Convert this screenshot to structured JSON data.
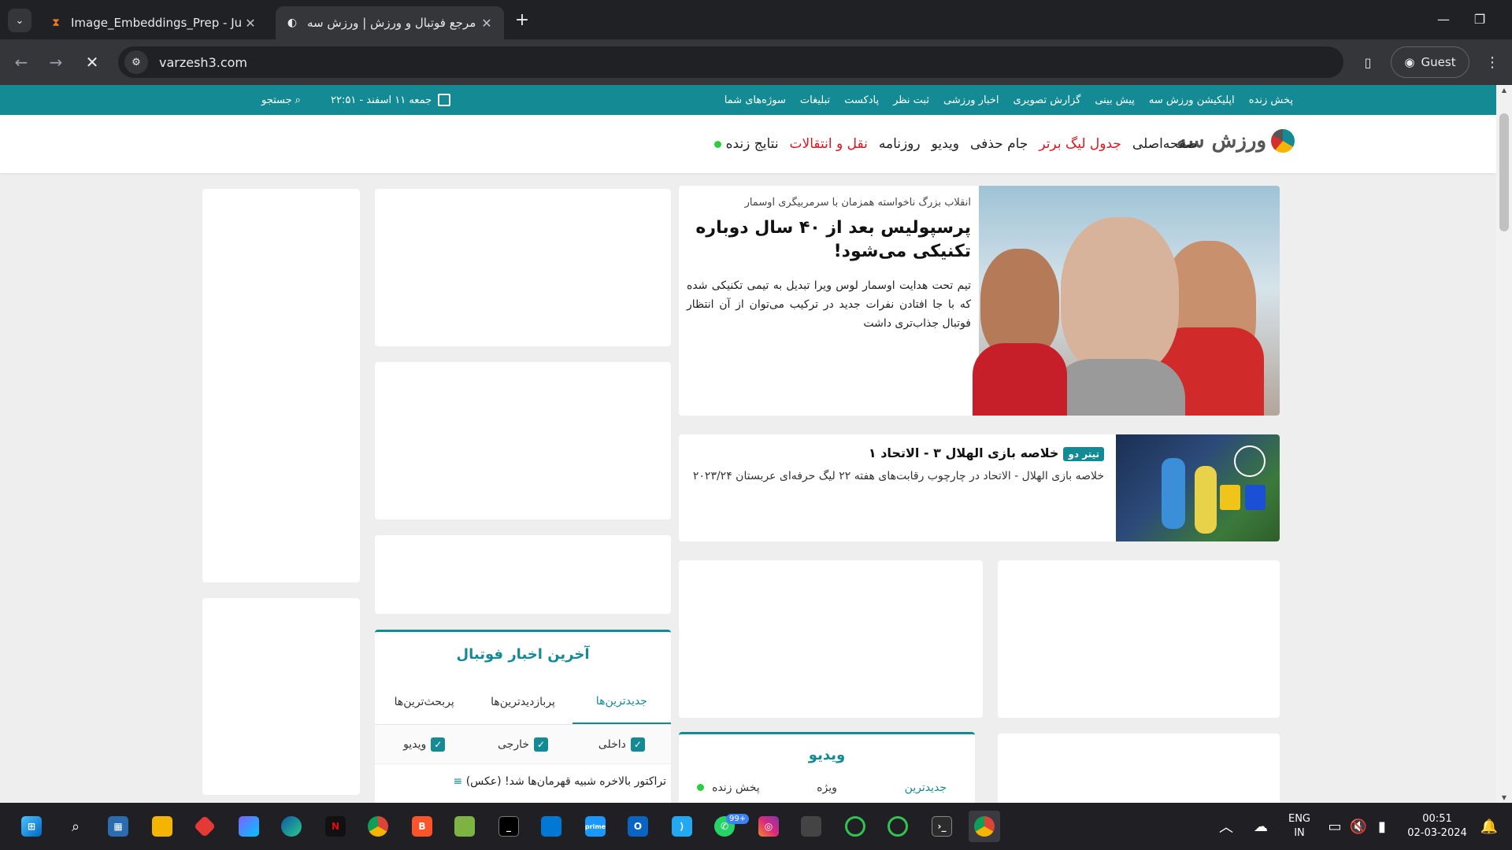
{
  "browser": {
    "tabs": [
      {
        "title": "Image_Embeddings_Prep - Jupy",
        "icon": "jupyter-hourglass-icon",
        "active": false
      },
      {
        "title": "مرجع فوتبال و ورزش | ورزش سه",
        "icon": "varzesh3-favicon-icon",
        "active": true
      }
    ],
    "url": "varzesh3.com",
    "profile_label": "Guest"
  },
  "site": {
    "topbar": {
      "menu": [
        "پخش زنده",
        "اپلیکیشن ورزش سه",
        "پیش بینی",
        "گزارش تصویری",
        "اخبار ورزشی",
        "ثبت نظر",
        "پادکست",
        "تبلیغات",
        "سوژه‌های شما"
      ],
      "date": "جمعه ۱۱ اسفند - ۲۲:۵۱",
      "search_label": "جستجو"
    },
    "logo_text": "ورزش سه",
    "nav": [
      {
        "label": "صفحه‌اصلی",
        "color": "#222222"
      },
      {
        "label": "جدول لیگ برتر",
        "color": "#e0141e"
      },
      {
        "label": "جام حذفی",
        "color": "#222222"
      },
      {
        "label": "ویدیو",
        "color": "#222222"
      },
      {
        "label": "روزنامه",
        "color": "#222222"
      },
      {
        "label": "نقل و انتقالات",
        "color": "#e0141e"
      },
      {
        "label": "نتایج زنده",
        "color": "#222222"
      }
    ],
    "hero": {
      "kicker": "انقلاب بزرگ ناخواسته همزمان با سرمربیگری اوسمار",
      "title": "پرسپولیس بعد از ۴۰ سال دوباره تکنیکی می‌شود!",
      "lead": "تیم تحت هدایت اوسمار لوس ویرا تبدیل به تیمی تکنیکی شده که با جا افتادن نفرات جدید در ترکیب می‌توان از آن انتظار فوتبال جذاب‌تری داشت"
    },
    "second_news": {
      "badge": "تیتر دو",
      "title": "خلاصه بازی الهلال ۳ - الاتحاد ۱",
      "desc": "خلاصه بازی الهلال - الاتحاد در چارچوب رقابت‌های هفته ۲۲ لیگ حرفه‌ای عربستان ۲۰۲۳/۲۴"
    },
    "football_news": {
      "heading": "آخرین اخبار فوتبال",
      "tabs": [
        "جدیدترین‌ها",
        "پربازدیدترین‌ها",
        "پربحث‌ترین‌ها"
      ],
      "filters": [
        "داخلی",
        "خارجی",
        "ویدیو"
      ],
      "first_item": "تراکتور بالاخره شبیه قهرمان‌ها شد! (عکس)"
    },
    "video": {
      "heading": "ویدیو",
      "tabs": [
        "جدیدترین",
        "ویژه",
        "پخش زنده"
      ]
    },
    "accent": "#148b94"
  },
  "taskbar": {
    "lang": "ENG",
    "region": "IN",
    "time": "00:51",
    "date": "02-03-2024",
    "whatsapp_badge": "99+"
  }
}
